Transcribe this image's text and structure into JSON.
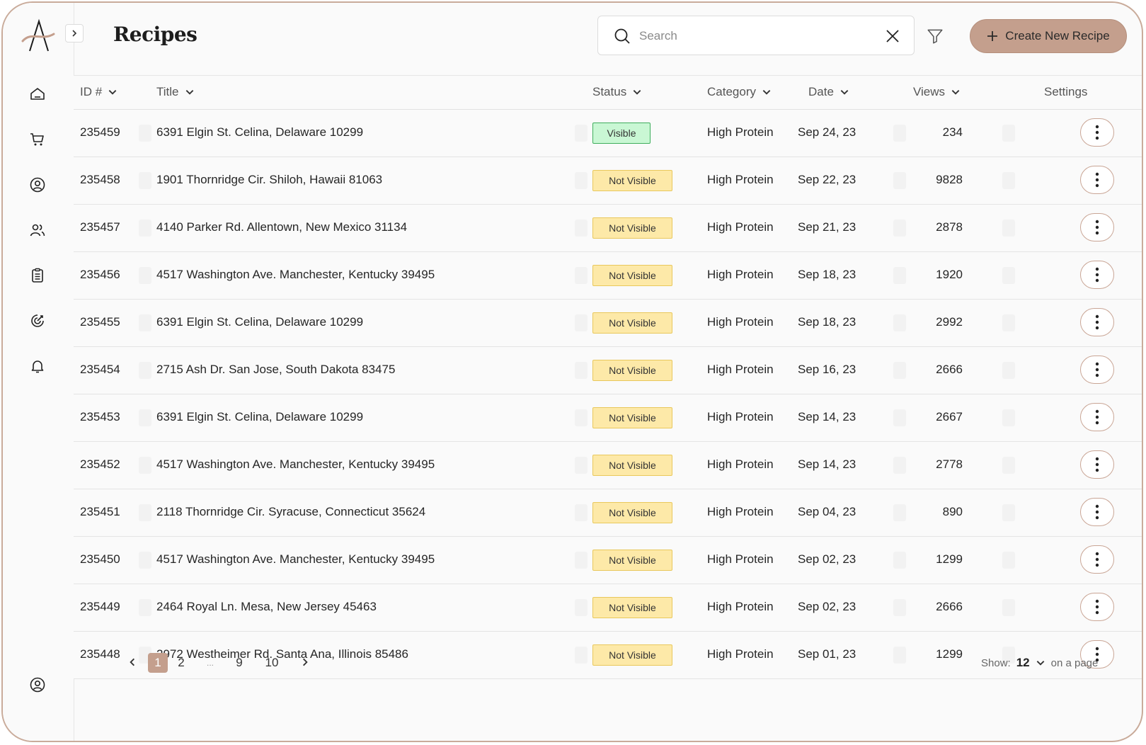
{
  "header": {
    "title": "Recipes",
    "search_placeholder": "Search",
    "create_label": "Create New Recipe"
  },
  "table": {
    "columns": {
      "id": "ID #",
      "title": "Title",
      "status": "Status",
      "category": "Category",
      "date": "Date",
      "views": "Views",
      "settings": "Settings"
    },
    "rows": [
      {
        "id": "235459",
        "title": "6391 Elgin St. Celina, Delaware 10299",
        "status": "Visible",
        "category": "High Protein",
        "date": "Sep 24, 23",
        "views": "234"
      },
      {
        "id": "235458",
        "title": "1901 Thornridge Cir. Shiloh, Hawaii 81063",
        "status": "Not Visible",
        "category": "High Protein",
        "date": "Sep 22, 23",
        "views": "9828"
      },
      {
        "id": "235457",
        "title": "4140 Parker Rd. Allentown, New Mexico 31134",
        "status": "Not Visible",
        "category": "High Protein",
        "date": "Sep 21, 23",
        "views": "2878"
      },
      {
        "id": "235456",
        "title": "4517 Washington Ave. Manchester, Kentucky 39495",
        "status": "Not Visible",
        "category": "High Protein",
        "date": "Sep 18, 23",
        "views": "1920"
      },
      {
        "id": "235455",
        "title": "6391 Elgin St. Celina, Delaware 10299",
        "status": "Not Visible",
        "category": "High Protein",
        "date": "Sep 18, 23",
        "views": "2992"
      },
      {
        "id": "235454",
        "title": "2715 Ash Dr. San Jose, South Dakota 83475",
        "status": "Not Visible",
        "category": "High Protein",
        "date": "Sep 16, 23",
        "views": "2666"
      },
      {
        "id": "235453",
        "title": "6391 Elgin St. Celina, Delaware 10299",
        "status": "Not Visible",
        "category": "High Protein",
        "date": "Sep 14, 23",
        "views": "2667"
      },
      {
        "id": "235452",
        "title": "4517 Washington Ave. Manchester, Kentucky 39495",
        "status": "Not Visible",
        "category": "High Protein",
        "date": "Sep 14, 23",
        "views": "2778"
      },
      {
        "id": "235451",
        "title": "2118 Thornridge Cir. Syracuse, Connecticut 35624",
        "status": "Not Visible",
        "category": "High Protein",
        "date": "Sep 04, 23",
        "views": "890"
      },
      {
        "id": "235450",
        "title": "4517 Washington Ave. Manchester, Kentucky 39495",
        "status": "Not Visible",
        "category": "High Protein",
        "date": "Sep 02, 23",
        "views": "1299"
      },
      {
        "id": "235449",
        "title": "2464 Royal Ln. Mesa, New Jersey 45463",
        "status": "Not Visible",
        "category": "High Protein",
        "date": "Sep 02, 23",
        "views": "2666"
      },
      {
        "id": "235448",
        "title": "2972 Westheimer Rd. Santa Ana, Illinois 85486",
        "status": "Not Visible",
        "category": "High Protein",
        "date": "Sep 01, 23",
        "views": "1299"
      }
    ]
  },
  "pagination": {
    "pages": [
      "1",
      "2",
      "...",
      "9",
      "10"
    ],
    "current": "1",
    "show_label": "Show:",
    "show_value": "12",
    "suffix": "on a page"
  },
  "sidebar": {
    "icons": [
      "home-icon",
      "cart-icon",
      "user-circle-icon",
      "users-icon",
      "clipboard-icon",
      "target-icon",
      "bell-icon"
    ],
    "bottom_icon": "profile-icon"
  },
  "colors": {
    "accent": "#c49f8d",
    "frame_border": "#c9ab9a",
    "visible_bg": "#c9f7d4",
    "visible_border": "#3fae5c",
    "notvisible_bg": "#fde9a8",
    "notvisible_border": "#e9c85c"
  }
}
